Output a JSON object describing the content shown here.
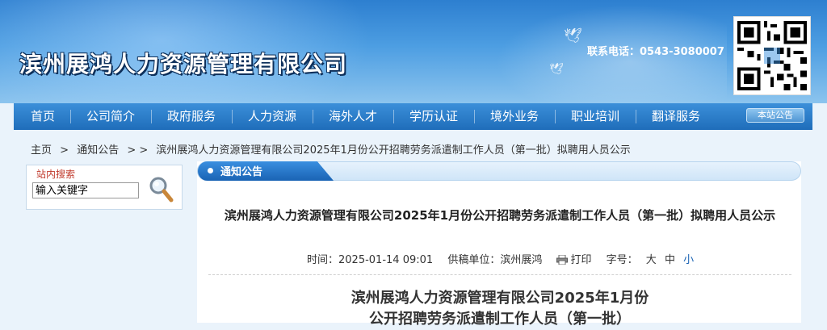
{
  "header": {
    "site_title": "滨州展鸿人力资源管理有限公司",
    "hotline": "联系电话：0543-3080007"
  },
  "nav": {
    "items": [
      "首页",
      "公司简介",
      "政府服务",
      "人力资源",
      "海外人才",
      "学历认证",
      "境外业务",
      "职业培训",
      "翻译服务"
    ],
    "notice_tab": "本站公告"
  },
  "breadcrumb": {
    "home": "主页",
    "sep1": ">",
    "section": "通知公告",
    "sep2": "> >",
    "current": "滨州展鸿人力资源管理有限公司2025年1月份公开招聘劳务派遣制工作人员（第一批）拟聘用人员公示"
  },
  "search": {
    "label": "站内搜索",
    "placeholder": "输入关键字",
    "icon": "magnifier-icon"
  },
  "section": {
    "title": "通知公告"
  },
  "article": {
    "title": "滨州展鸿人力资源管理有限公司2025年1月份公开招聘劳务派遣制工作人员（第一批）拟聘用人员公示",
    "time_label": "时间：",
    "time_value": "2025-01-14 09:01",
    "source_label": "供稿单位：",
    "source_value": "滨州展鸿",
    "print_label": "打印",
    "font_label": "字号：",
    "font_sizes": [
      "大",
      "中",
      "小"
    ],
    "body_heading_line1": "滨州展鸿人力资源管理有限公司2025年1月份",
    "body_heading_line2": "公开招聘劳务派遣制工作人员（第一批）"
  },
  "colors": {
    "nav_bg": "#1f6dba",
    "header_bg": "#4d9ee2",
    "accent": "#1a63b4"
  }
}
